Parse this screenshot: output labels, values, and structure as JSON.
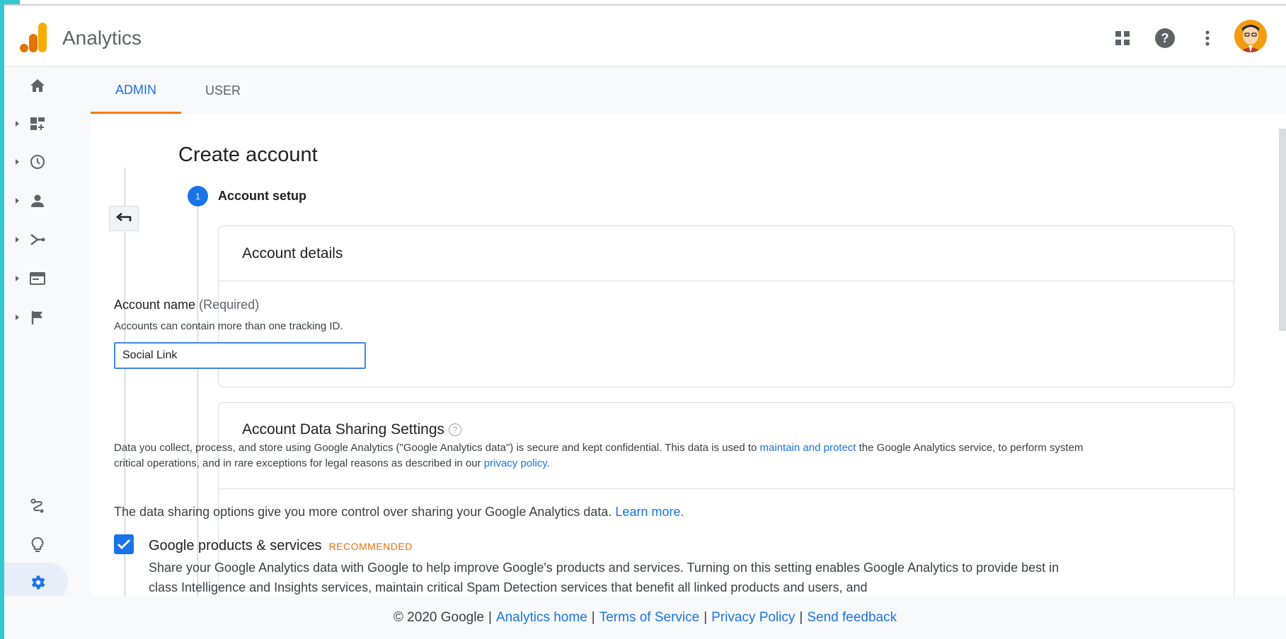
{
  "header": {
    "app_title": "Analytics",
    "icons": [
      "apps-grid-icon",
      "help-icon",
      "more-vert-icon",
      "account-avatar"
    ]
  },
  "tabs": [
    {
      "label": "ADMIN",
      "active": true
    },
    {
      "label": "USER",
      "active": false
    }
  ],
  "rail": {
    "items": [
      "home-icon",
      "customization-icon",
      "realtime-icon",
      "audience-icon",
      "acquisition-icon",
      "behavior-icon",
      "conversions-icon"
    ],
    "bottom_items": [
      "attribution-icon",
      "discover-icon",
      "admin-gear-icon"
    ],
    "expand_icon": "chevron-right-icon"
  },
  "main": {
    "page_title": "Create account",
    "step": {
      "number": "1",
      "label": "Account setup"
    },
    "account_details": {
      "heading": "Account details",
      "field_label": "Account name",
      "field_required": "(Required)",
      "field_help": "Accounts can contain more than one tracking ID.",
      "field_value": "Social Link"
    },
    "sharing": {
      "heading": "Account Data Sharing Settings",
      "help_glyph": "?",
      "desc_part1": "Data you collect, process, and store using Google Analytics (\"Google Analytics data\") is secure and kept confidential. This data is used to ",
      "desc_link1": "maintain and protect",
      "desc_part2": " the Google Analytics service, to perform system critical operations, and in rare exceptions for legal reasons as described in our ",
      "desc_link2": "privacy policy",
      "desc_part3": ".",
      "options_intro": "The data sharing options give you more control over sharing your Google Analytics data.",
      "learn_more": "Learn more.",
      "option1": {
        "title": "Google products & services",
        "badge": "RECOMMENDED",
        "checked": true,
        "desc": "Share your Google Analytics data with Google to help improve Google's products and services. Turning on this setting enables Google Analytics to provide best in class Intelligence and Insights services, maintain critical Spam Detection services that benefit all linked products and users, and"
      }
    }
  },
  "footer": {
    "copyright": "© 2020 Google",
    "links": [
      "Analytics home",
      "Terms of Service",
      "Privacy Policy",
      "Send feedback"
    ],
    "separator": "|"
  },
  "colors": {
    "accent_blue": "#1a73e8",
    "tab_indicator": "#f57c00",
    "badge_orange": "#e8710a",
    "frame_teal": "#35c8d2"
  }
}
